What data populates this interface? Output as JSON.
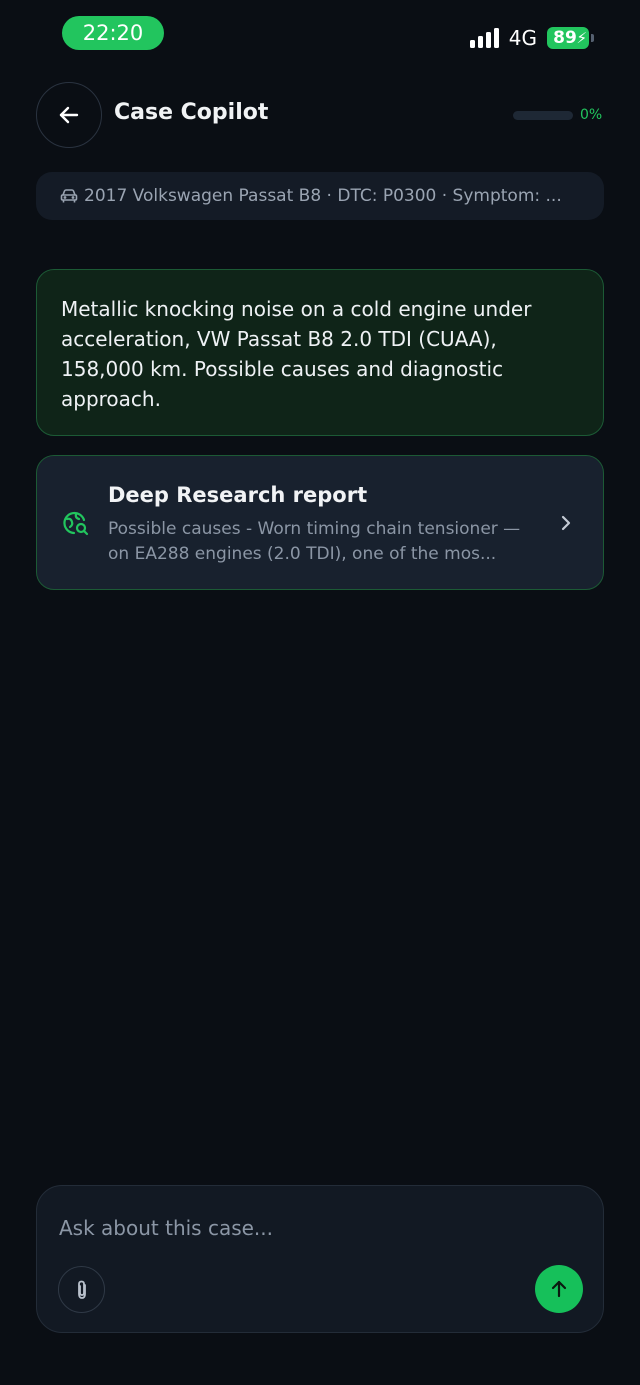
{
  "status_bar": {
    "time": "22:20",
    "network": "4G",
    "battery": "89"
  },
  "header": {
    "title": "Case Copilot",
    "progress_value": 0,
    "progress_label": "0%"
  },
  "context": {
    "text": "2017 Volkswagen Passat B8 · DTC: P0300 · Symptom: ..."
  },
  "messages": [
    {
      "role": "user",
      "text": "Metallic knocking noise on a cold engine under acceleration, VW Passat B8 2.0 TDI (CUAA), 158,000 km. Possible causes and diagnostic approach."
    }
  ],
  "research_card": {
    "title": "Deep Research report",
    "preview": "Possible causes  - Worn timing chain tensioner — on EA288 engines (2.0 TDI), one of the mos..."
  },
  "composer": {
    "placeholder": "Ask about this case..."
  },
  "icons": {
    "back": "arrow-left-icon",
    "car": "car-icon",
    "research": "globe-search-icon",
    "chevron": "chevron-right-icon",
    "attach": "paperclip-icon",
    "send": "arrow-up-icon"
  },
  "colors": {
    "accent": "#22c55e",
    "background": "#0a0e14",
    "card": "#18212e",
    "user_bubble": "#0f2418"
  }
}
